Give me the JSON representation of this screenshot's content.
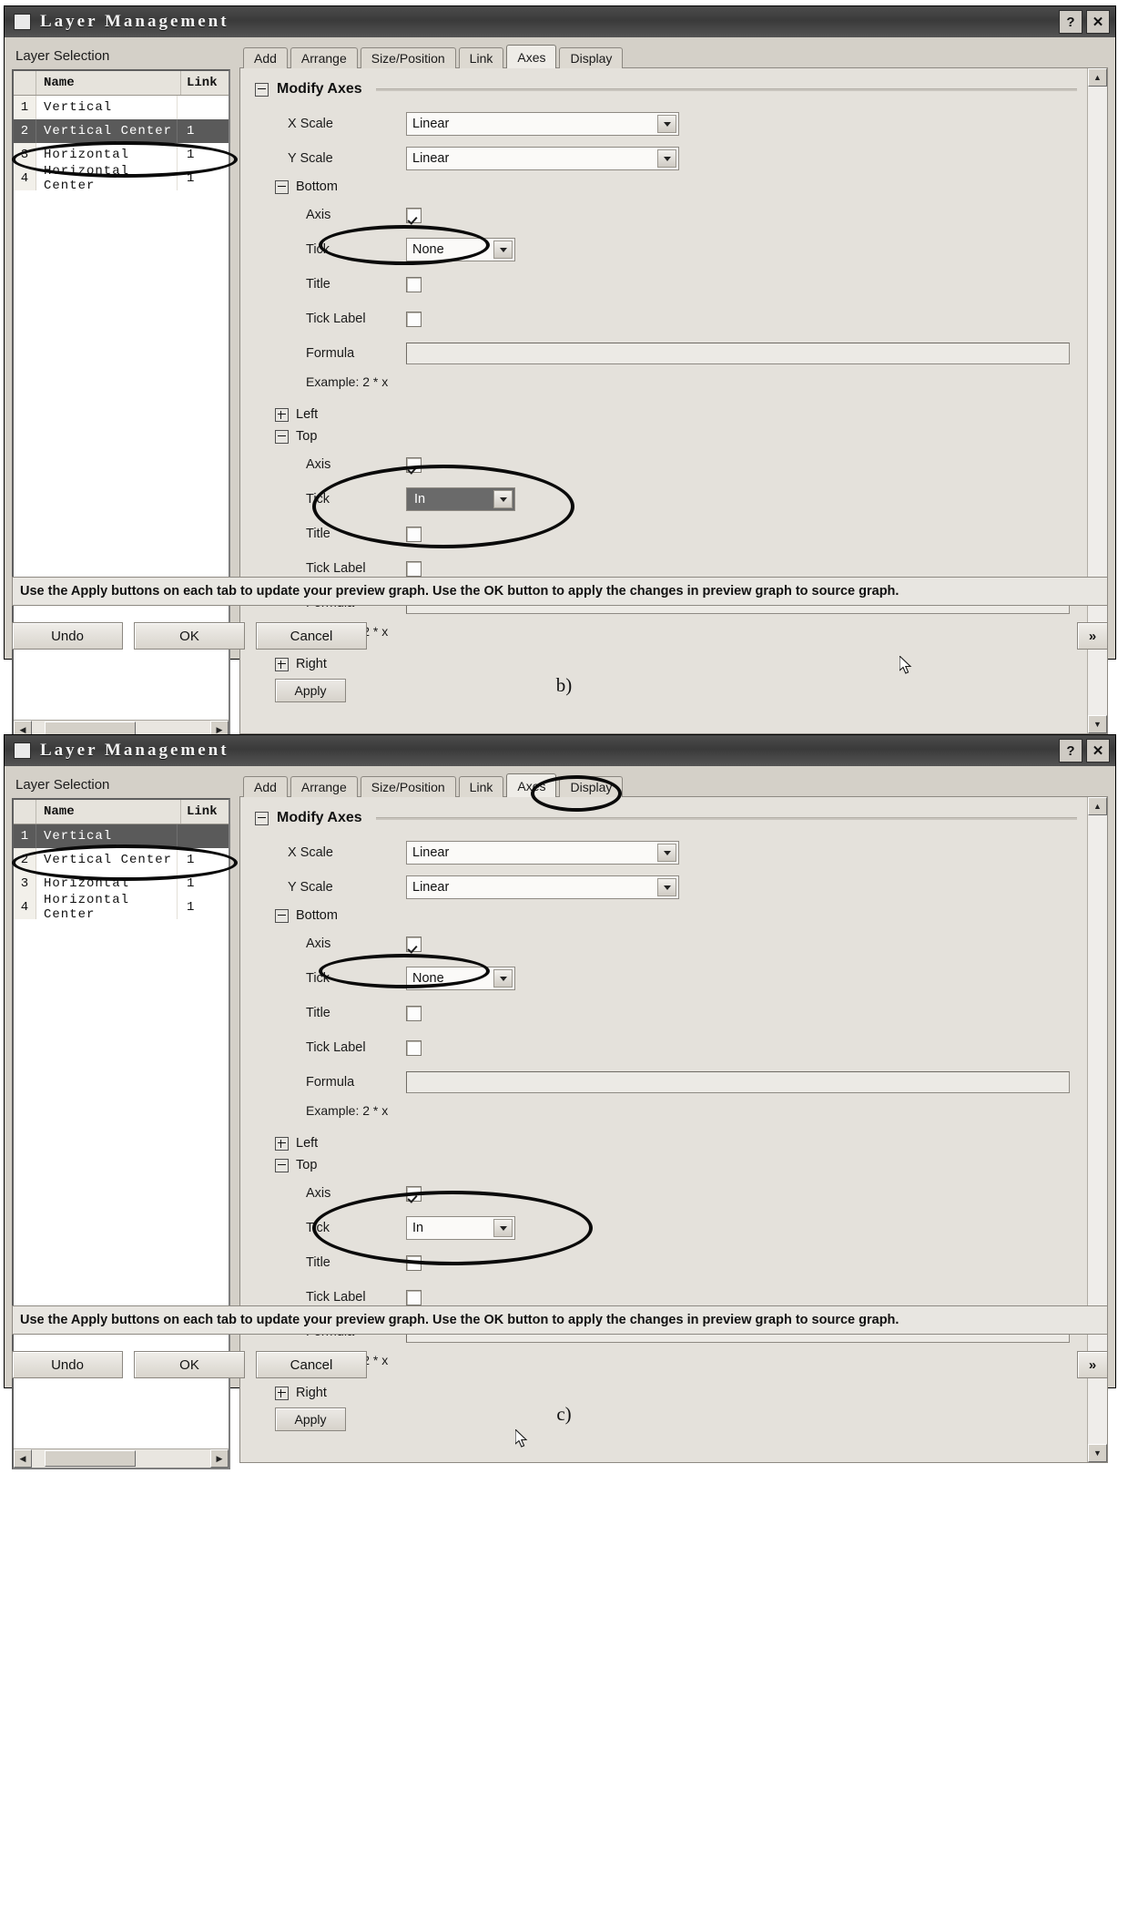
{
  "figure": {
    "caption_b": "b)",
    "caption_c": "c)"
  },
  "window": {
    "title": "Layer  Management",
    "help_button": "?",
    "close_button": "✕"
  },
  "layer_selection": {
    "caption": "Layer Selection",
    "columns": [
      "",
      "Name",
      "Link"
    ],
    "header_name": "Name",
    "header_link": "Link",
    "rows_b": [
      {
        "num": "1",
        "name": "Vertical",
        "link": ""
      },
      {
        "num": "2",
        "name": "Vertical Center",
        "link": "1"
      },
      {
        "num": "3",
        "name": "Horizontal",
        "link": "1"
      },
      {
        "num": "4",
        "name": "Horizontal Center",
        "link": "1"
      }
    ],
    "rows_c": [
      {
        "num": "1",
        "name": "Vertical",
        "link": ""
      },
      {
        "num": "2",
        "name": "Vertical Center",
        "link": "1"
      },
      {
        "num": "3",
        "name": "Horizontal",
        "link": "1"
      },
      {
        "num": "4",
        "name": "Horizontal Center",
        "link": "1"
      }
    ],
    "selected_b": "Vertical Center",
    "selected_c": "Vertical",
    "scroll_left_arrow": "◀",
    "scroll_right_arrow": "▶"
  },
  "tabs": {
    "items": [
      "Add",
      "Arrange",
      "Size/Position",
      "Link",
      "Axes",
      "Display"
    ],
    "active": "Axes"
  },
  "axes_panel": {
    "section_title": "Modify Axes",
    "x_scale_label": "X Scale",
    "x_scale_value": "Linear",
    "y_scale_label": "Y Scale",
    "y_scale_value": "Linear",
    "bottom_label": "Bottom",
    "left_label": "Left",
    "top_label": "Top",
    "right_label": "Right",
    "axis_label": "Axis",
    "tick_label": "Tick",
    "title_label": "Title",
    "ticklabel_label": "Tick Label",
    "formula_label": "Formula",
    "formula_value": "",
    "example_text": "Example: 2 * x",
    "bottom_tick_value": "None",
    "top_tick_value": "In",
    "apply_label": "Apply",
    "bottom_axis_checked": true,
    "bottom_title_checked": false,
    "bottom_ticklabel_checked": false,
    "top_axis_checked": true,
    "top_title_checked": false,
    "top_ticklabel_checked": false
  },
  "hint": {
    "text": "Use the Apply buttons on each tab to update your preview graph. Use the OK button to apply the changes in preview graph to source graph."
  },
  "footer": {
    "undo": "Undo",
    "ok": "OK",
    "cancel": "Cancel",
    "more": "»"
  },
  "scrollbars": {
    "up_arrow": "▲",
    "down_arrow": "▼"
  }
}
